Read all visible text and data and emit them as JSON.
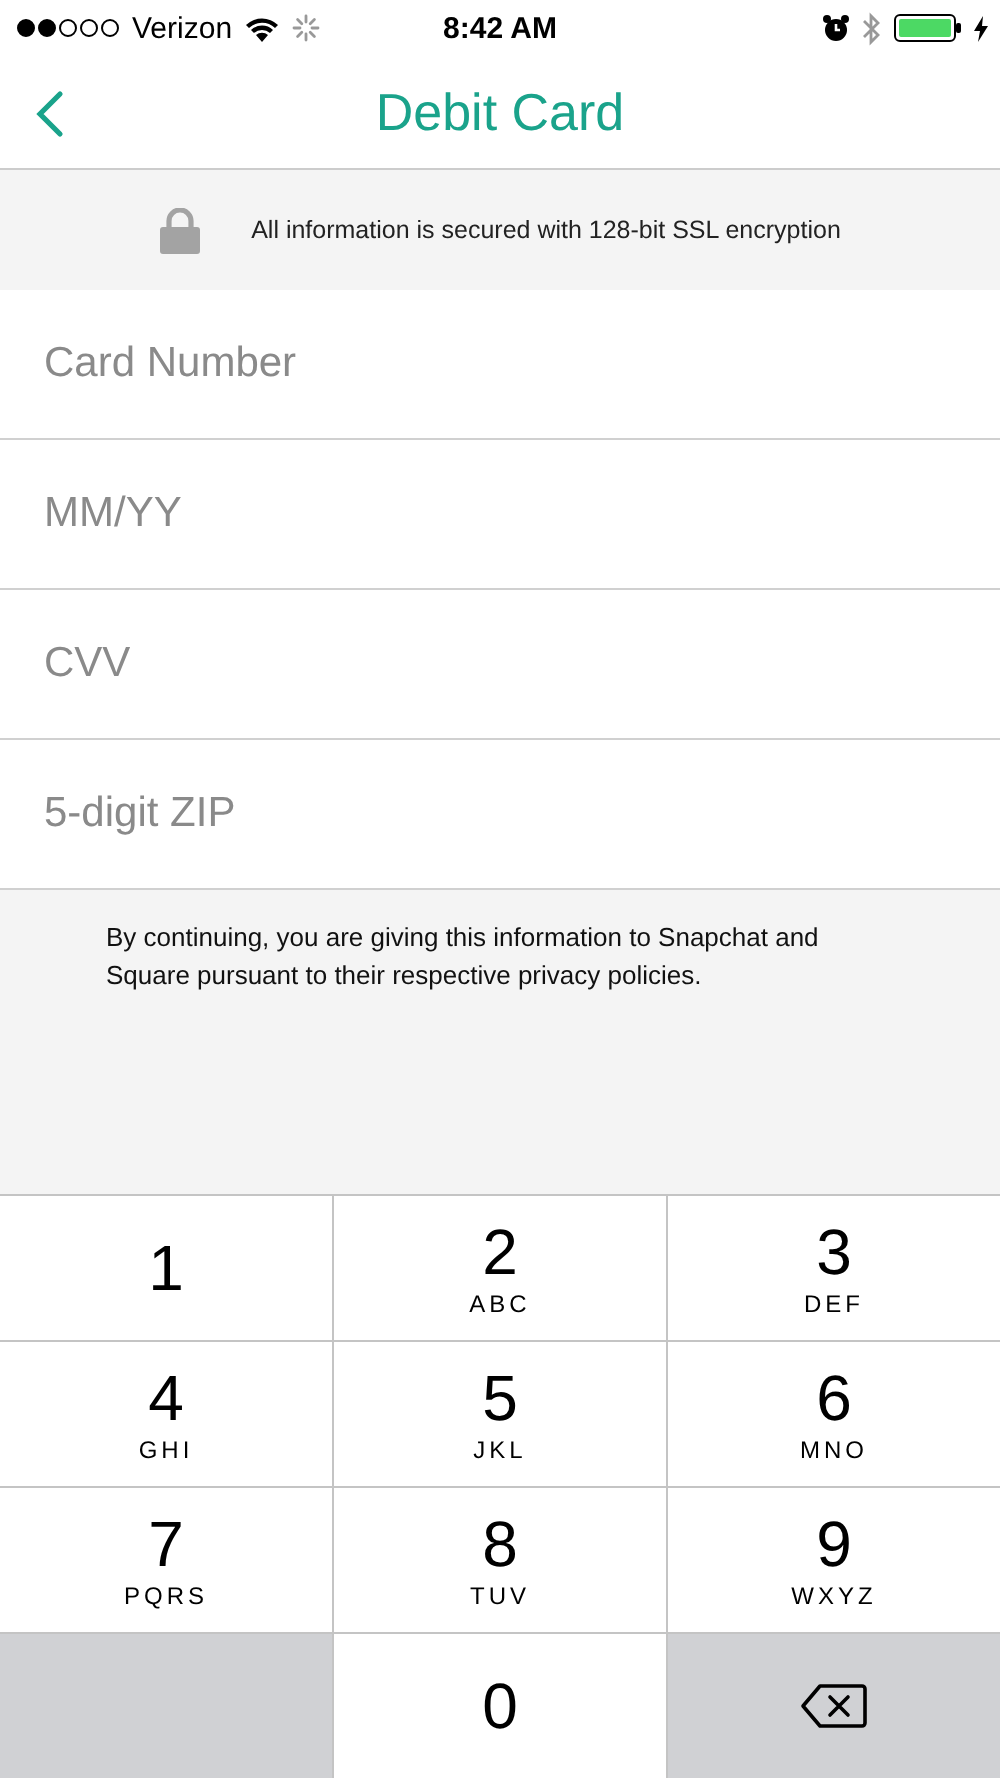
{
  "status_bar": {
    "carrier": "Verizon",
    "time": "8:42 AM"
  },
  "nav": {
    "title": "Debit Card"
  },
  "banner": {
    "text": "All information is secured with 128-bit SSL encryption"
  },
  "fields": [
    {
      "placeholder": "Card Number"
    },
    {
      "placeholder": "MM/YY"
    },
    {
      "placeholder": "CVV"
    },
    {
      "placeholder": "5-digit ZIP"
    }
  ],
  "note": "By continuing, you are giving this information to Snapchat and Square pursuant to their respective privacy policies.",
  "keypad": [
    {
      "kind": "digit",
      "digit": "1"
    },
    {
      "kind": "digit",
      "digit": "2",
      "letters": "ABC"
    },
    {
      "kind": "digit",
      "digit": "3",
      "letters": "DEF"
    },
    {
      "kind": "digit",
      "digit": "4",
      "letters": "GHI"
    },
    {
      "kind": "digit",
      "digit": "5",
      "letters": "JKL"
    },
    {
      "kind": "digit",
      "digit": "6",
      "letters": "MNO"
    },
    {
      "kind": "digit",
      "digit": "7",
      "letters": "PQRS"
    },
    {
      "kind": "digit",
      "digit": "8",
      "letters": "TUV"
    },
    {
      "kind": "digit",
      "digit": "9",
      "letters": "WXYZ"
    },
    {
      "kind": "blank"
    },
    {
      "kind": "digit",
      "digit": "0"
    },
    {
      "kind": "delete"
    }
  ]
}
